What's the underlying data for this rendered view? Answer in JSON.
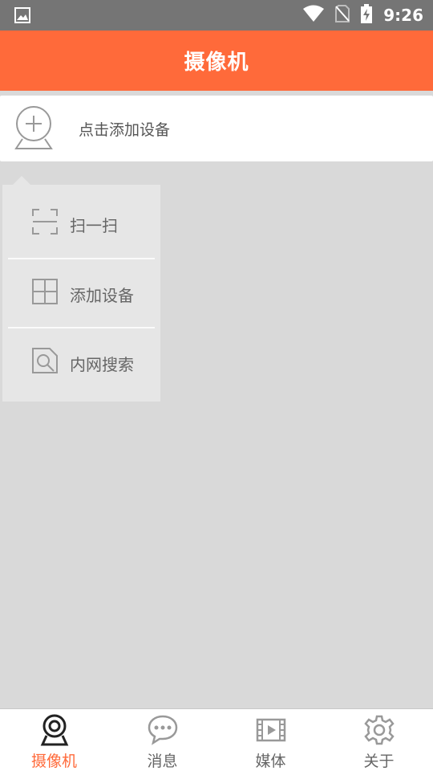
{
  "status_bar": {
    "time": "9:26",
    "icons": [
      "image-icon",
      "wifi-icon",
      "no-sim-icon",
      "battery-charging-icon"
    ]
  },
  "app_bar": {
    "title": "摄像机"
  },
  "add_device": {
    "label": "点击添加设备",
    "icon": "camera-add-icon"
  },
  "popup_menu": {
    "items": [
      {
        "label": "扫一扫",
        "icon": "scan-icon"
      },
      {
        "label": "添加设备",
        "icon": "grid-add-icon"
      },
      {
        "label": "内网搜索",
        "icon": "search-doc-icon"
      }
    ]
  },
  "bottom_nav": {
    "active_color": "#ff6a3a",
    "items": [
      {
        "label": "摄像机",
        "icon": "camera-icon",
        "active": true
      },
      {
        "label": "消息",
        "icon": "message-icon",
        "active": false
      },
      {
        "label": "媒体",
        "icon": "film-icon",
        "active": false
      },
      {
        "label": "关于",
        "icon": "gear-icon",
        "active": false
      }
    ]
  },
  "colors": {
    "accent": "#ff6a3a",
    "status_bar": "#757575",
    "background": "#d9d9d9"
  }
}
